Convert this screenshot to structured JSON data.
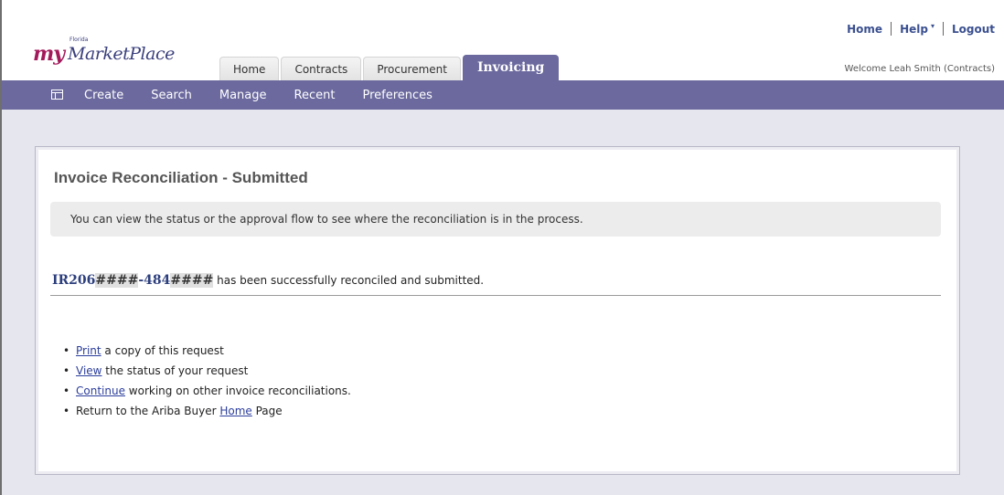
{
  "header": {
    "logo_my": "my",
    "logo_small": "Florida",
    "logo_marketplace": "MarketPlace",
    "top_links": {
      "home": "Home",
      "help": "Help",
      "logout": "Logout"
    },
    "welcome": "Welcome Leah Smith (Contracts)"
  },
  "tabs": [
    {
      "label": "Home"
    },
    {
      "label": "Contracts"
    },
    {
      "label": "Procurement"
    },
    {
      "label": "Invoicing"
    }
  ],
  "nav": {
    "items": [
      "Create",
      "Search",
      "Manage",
      "Recent",
      "Preferences"
    ]
  },
  "panel": {
    "title": "Invoice Reconciliation - Submitted",
    "info": "You can view the status or the approval flow to see where the reconciliation is in the process.",
    "ir_prefix": "IR206",
    "ir_mask1": "####",
    "ir_mid": "-484",
    "ir_mask2": "####",
    "result_text": "has been successfully reconciled and submitted.",
    "actions": [
      {
        "link": "Print",
        "pre": "",
        "post": " a copy of this request"
      },
      {
        "link": "View",
        "pre": "",
        "post": " the status of your request"
      },
      {
        "link": "Continue",
        "pre": "",
        "post": " working on other invoice reconciliations."
      },
      {
        "link": "Home",
        "pre": "Return to the Ariba Buyer ",
        "post": " Page"
      }
    ]
  },
  "colors": {
    "brand_purple": "#6b699e",
    "link_blue": "#2c3e9c",
    "content_bg": "#e6e6ee"
  }
}
